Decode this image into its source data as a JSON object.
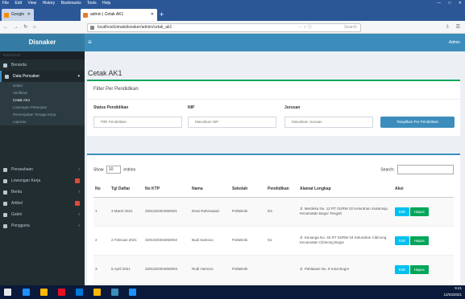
{
  "window": {
    "menu_items": [
      "File",
      "Edit",
      "View",
      "History",
      "Bookmarks",
      "Tools",
      "Help"
    ],
    "controls": [
      "—",
      "□",
      "✕"
    ]
  },
  "tabs": [
    {
      "label": "Google",
      "close": "✕"
    },
    {
      "label": "admin | Cetak AK1",
      "close": "✕"
    }
  ],
  "new_tab": "+",
  "nav": {
    "back": "←",
    "forward": "→",
    "reload": "↻",
    "home": "⌂",
    "url": "localhost/simakdisnaker/admin/cetak_ak1",
    "url_icons": "··· ☆ ⓘ",
    "search_placeholder": "Search",
    "right_icons": [
      "⇩",
      "☰"
    ]
  },
  "app": {
    "brand": "Disnaker",
    "toggle": "≡",
    "user": "Admin"
  },
  "sidebar": {
    "header": "NAVIGASI",
    "items": [
      {
        "label": "Beranda"
      },
      {
        "label": "Data Pencaker",
        "active": true,
        "caret": "▾"
      }
    ],
    "subitems": [
      {
        "label": "Daftar"
      },
      {
        "label": "Verifikasi"
      },
      {
        "label": "Cetak AK1",
        "selected": true
      },
      {
        "label": "Lowongan Pekerjaan"
      },
      {
        "label": "Penempatan Tenaga Kerja"
      },
      {
        "label": "Laporan"
      }
    ],
    "more_items": [
      {
        "label": "Perusahaan",
        "caret": "‹"
      },
      {
        "label": "Lowongan Kerja",
        "badge": true
      },
      {
        "label": "Berita",
        "caret": "‹"
      },
      {
        "label": "Artikel",
        "badge": true
      },
      {
        "label": "Galeri",
        "caret": "‹"
      },
      {
        "label": "Pengguna",
        "caret": "‹"
      }
    ]
  },
  "page": {
    "title": "Cetak AK1",
    "filter_box": {
      "title": "Filter Per Pendidikan",
      "fields": [
        {
          "label": "Status Pendidikan",
          "placeholder": "Pilih Pendidikan"
        },
        {
          "label": "NIP",
          "placeholder": "Masukkan NIP"
        },
        {
          "label": "Jurusan",
          "placeholder": "Masukkan Jurusan"
        }
      ],
      "button": "Tampilkan Per Pendidikan"
    },
    "table_box": {
      "show_label": "Show",
      "show_value": "10",
      "entries_label": "entries",
      "search_label": "Search:",
      "columns": [
        "No",
        "Tgl Daftar",
        "No KTP",
        "Nama",
        "Sekolah",
        "Pendidikan",
        "Alamat Lengkap",
        "Aksi"
      ],
      "rows": [
        {
          "no": "1",
          "date": "3 Maret 2021",
          "ktp": "3201020304050001",
          "name": "Dewi Rahmawati",
          "school": "Politeknik",
          "edu": "D3",
          "address": "Jl. Merdeka No. 12 RT 01/RW 02 Kelurahan Sukamaju Kecamatan Bogor Tengah",
          "edit": "Edit",
          "hapus": "Hapus"
        },
        {
          "no": "2",
          "date": "2 Februari 2021",
          "ktp": "3201020304050002",
          "name": "Budi Santoso",
          "school": "Politeknik",
          "edu": "S1",
          "address": "Jl. Kenanga No. 45 RT 03/RW 04 Kelurahan Cibinong Kecamatan Cibinong Bogor",
          "edit": "Edit",
          "hapus": "Hapus"
        },
        {
          "no": "3",
          "date": "5 April 2021",
          "ktp": "3201020304050003",
          "name": "Rudi Hartono",
          "school": "Politeknik",
          "edu": "",
          "address": "Jl. Pahlawan No. 8 Kota Bogor",
          "edit": "Edit",
          "hapus": "Hapus"
        }
      ]
    }
  },
  "taskbar": {
    "time": "9:41",
    "date": "12/03/2021",
    "icon_colors": [
      "#1e90ff",
      "#ffb900",
      "#e81123",
      "#0078d7",
      "#ffb900",
      "#3c8dbc"
    ]
  }
}
